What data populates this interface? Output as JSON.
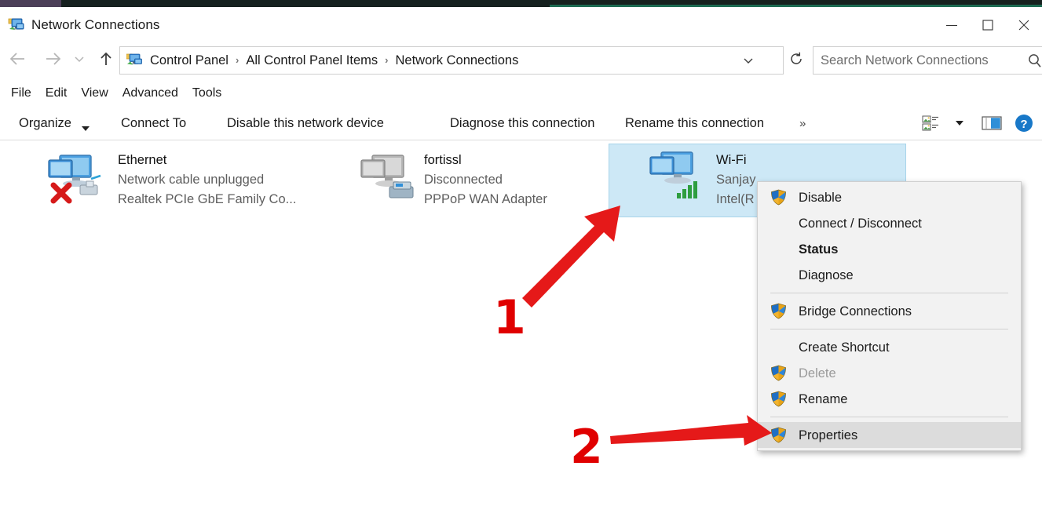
{
  "window": {
    "title": "Network Connections",
    "icon": "network-connections-icon",
    "controls": {
      "minimize": "minimize-icon",
      "maximize": "maximize-icon",
      "close": "close-icon"
    }
  },
  "navbar": {
    "back": "back-arrow-icon",
    "forward": "forward-arrow-icon",
    "recent": "recent-locations-icon",
    "up": "up-arrow-icon",
    "breadcrumbs": [
      "Control Panel",
      "All Control Panel Items",
      "Network Connections"
    ],
    "separator": "›",
    "dropdown": "chevron-down-icon",
    "refresh": "refresh-icon"
  },
  "search": {
    "placeholder": "Search Network Connections",
    "icon": "search-icon"
  },
  "menubar": {
    "items": [
      "File",
      "Edit",
      "View",
      "Advanced",
      "Tools"
    ]
  },
  "commandbar": {
    "organize": "Organize",
    "connect_to": "Connect To",
    "disable_device": "Disable this network device",
    "diagnose": "Diagnose this connection",
    "rename": "Rename this connection",
    "overflow": "»",
    "view_icon": "change-view-icon",
    "view_caret": "chevron-down-icon",
    "preview_icon": "preview-pane-icon",
    "help_icon": "help-icon"
  },
  "connections": [
    {
      "name": "Ethernet",
      "status": "Network cable unplugged",
      "adapter": "Realtek PCIe GbE Family Co...",
      "icon": "ethernet-disconnected-icon",
      "selected": false
    },
    {
      "name": "fortissl",
      "status": "Disconnected",
      "adapter": "PPPoP WAN Adapter",
      "icon": "dialup-disconnected-icon",
      "selected": false
    },
    {
      "name": "Wi-Fi",
      "status": "Sanjay",
      "adapter": "Intel(R",
      "icon": "wifi-connected-icon",
      "selected": true
    }
  ],
  "context_menu": {
    "items": [
      {
        "label": "Disable",
        "icon": "shield-icon",
        "state": "normal"
      },
      {
        "label": "Connect / Disconnect",
        "icon": "",
        "state": "normal"
      },
      {
        "label": "Status",
        "icon": "",
        "state": "bold"
      },
      {
        "label": "Diagnose",
        "icon": "",
        "state": "normal"
      },
      {
        "label": "__SEPARATOR__",
        "icon": "",
        "state": "separator"
      },
      {
        "label": "Bridge Connections",
        "icon": "shield-icon",
        "state": "normal"
      },
      {
        "label": "__SEPARATOR__",
        "icon": "",
        "state": "separator"
      },
      {
        "label": "Create Shortcut",
        "icon": "",
        "state": "normal"
      },
      {
        "label": "Delete",
        "icon": "shield-icon",
        "state": "disabled"
      },
      {
        "label": "Rename",
        "icon": "shield-icon",
        "state": "normal"
      },
      {
        "label": "__SEPARATOR__",
        "icon": "",
        "state": "separator"
      },
      {
        "label": "Properties",
        "icon": "shield-icon",
        "state": "highlight"
      }
    ]
  },
  "annotations": {
    "step_one": "1",
    "step_two": "2",
    "arrow_color": "#e51919"
  }
}
